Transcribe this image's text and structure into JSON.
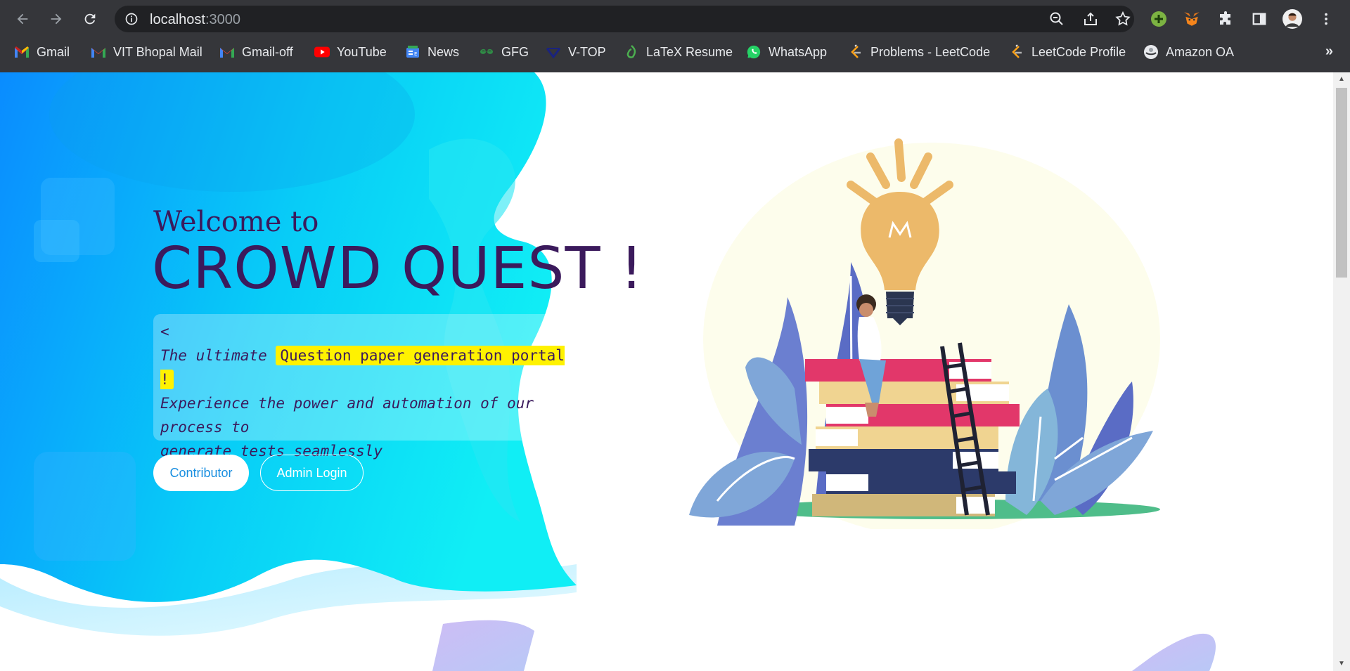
{
  "browser": {
    "url_host": "localhost",
    "url_port": ":3000",
    "nav": {
      "back_icon": "arrow-left-icon",
      "forward_icon": "arrow-right-icon",
      "reload_icon": "reload-icon"
    },
    "omnibox_icons": [
      "info-icon",
      "zoom-out-icon",
      "share-icon",
      "star-icon"
    ],
    "extensions": [
      "green-plus-extension-icon",
      "metamask-fox-icon",
      "puzzle-extensions-icon",
      "side-panel-icon",
      "profile-avatar",
      "kebab-menu-icon"
    ]
  },
  "bookmarks": [
    {
      "label": "Gmail",
      "icon": "gmail-icon"
    },
    {
      "label": "VIT Bhopal Mail",
      "icon": "gmail-icon"
    },
    {
      "label": "Gmail-off",
      "icon": "gmail-icon"
    },
    {
      "label": "YouTube",
      "icon": "youtube-icon"
    },
    {
      "label": "News",
      "icon": "google-news-icon"
    },
    {
      "label": "GFG",
      "icon": "gfg-icon"
    },
    {
      "label": "V-TOP",
      "icon": "vtop-icon"
    },
    {
      "label": "LaTeX Resume",
      "icon": "overleaf-icon"
    },
    {
      "label": "WhatsApp",
      "icon": "whatsapp-icon"
    },
    {
      "label": "Problems - LeetCode",
      "icon": "leetcode-icon"
    },
    {
      "label": "LeetCode Profile",
      "icon": "leetcode-icon"
    },
    {
      "label": "Amazon OA",
      "icon": "globe-icon"
    }
  ],
  "bookmarks_overflow": "»",
  "hero": {
    "welcome": "Welcome to",
    "brand": "CROWD QUEST !",
    "code_open": "<",
    "line1_prefix": "The ultimate ",
    "line1_highlight": "Question paper generation portal !",
    "line2": "Experience the power and automation of our process to",
    "line3": "generate tests seamlessly",
    "code_close": "/>",
    "contributor_button": "Contributor",
    "admin_button": "Admin Login"
  },
  "colors": {
    "heading": "#3b1a5c",
    "highlight": "#fff200",
    "gradient_start": "#0a8cff",
    "gradient_end": "#10eef5",
    "contributor_text": "#1a8fe0"
  }
}
